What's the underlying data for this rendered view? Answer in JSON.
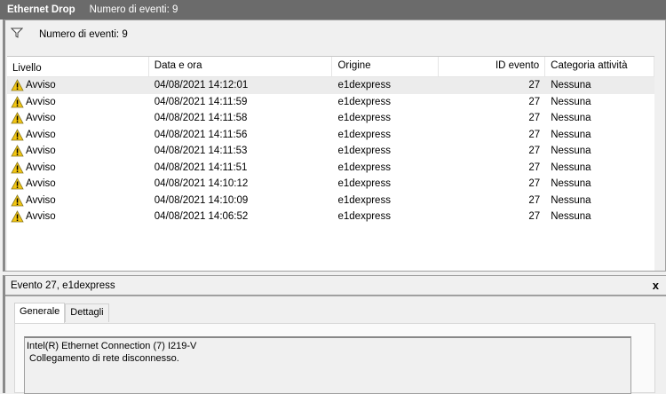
{
  "title": {
    "name": "Ethernet Drop",
    "count": "Numero di eventi: 9"
  },
  "filter": {
    "icon": "filter-icon",
    "label": "Numero di eventi: 9"
  },
  "columns": [
    "Livello",
    "Data e ora",
    "Origine",
    "ID evento",
    "Categoria attività"
  ],
  "rows": [
    {
      "level": "Avviso",
      "date": "04/08/2021 14:12:01",
      "source": "e1dexpress",
      "id": "27",
      "category": "Nessuna"
    },
    {
      "level": "Avviso",
      "date": "04/08/2021 14:11:59",
      "source": "e1dexpress",
      "id": "27",
      "category": "Nessuna"
    },
    {
      "level": "Avviso",
      "date": "04/08/2021 14:11:58",
      "source": "e1dexpress",
      "id": "27",
      "category": "Nessuna"
    },
    {
      "level": "Avviso",
      "date": "04/08/2021 14:11:56",
      "source": "e1dexpress",
      "id": "27",
      "category": "Nessuna"
    },
    {
      "level": "Avviso",
      "date": "04/08/2021 14:11:53",
      "source": "e1dexpress",
      "id": "27",
      "category": "Nessuna"
    },
    {
      "level": "Avviso",
      "date": "04/08/2021 14:11:51",
      "source": "e1dexpress",
      "id": "27",
      "category": "Nessuna"
    },
    {
      "level": "Avviso",
      "date": "04/08/2021 14:10:12",
      "source": "e1dexpress",
      "id": "27",
      "category": "Nessuna"
    },
    {
      "level": "Avviso",
      "date": "04/08/2021 14:10:09",
      "source": "e1dexpress",
      "id": "27",
      "category": "Nessuna"
    },
    {
      "level": "Avviso",
      "date": "04/08/2021 14:06:52",
      "source": "e1dexpress",
      "id": "27",
      "category": "Nessuna"
    }
  ],
  "detail": {
    "title": "Evento 27, e1dexpress",
    "close": "x",
    "tabs": [
      "Generale",
      "Dettagli"
    ],
    "line1": "Intel(R) Ethernet Connection (7) I219-V",
    "line2": " Collegamento di rete disconnesso."
  }
}
